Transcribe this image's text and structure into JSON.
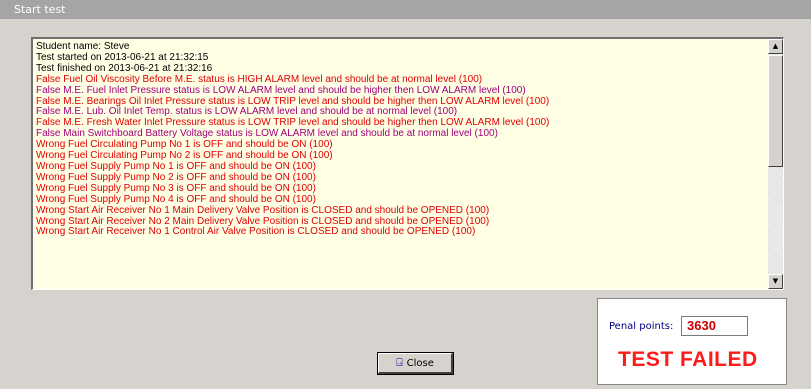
{
  "window": {
    "title": "Start test"
  },
  "log": {
    "lines": [
      {
        "text": "Student name: Steve",
        "color": "#000000"
      },
      {
        "text": "Test started on 2013-06-21 at 21:32:15",
        "color": "#000000"
      },
      {
        "text": "Test finished on 2013-06-21 at 21:32:16",
        "color": "#000000"
      },
      {
        "text": "False Fuel Oil Viscosity Before M.E. status is HIGH ALARM level and should be at normal level (100)",
        "color": "#e00000"
      },
      {
        "text": "False M.E. Fuel Inlet Pressure status is LOW ALARM level and should be higher then LOW ALARM level (100)",
        "color": "#a0007a"
      },
      {
        "text": "False M.E. Bearings Oil Inlet Pressure status is LOW TRIP level and should be higher then LOW ALARM level (100)",
        "color": "#e00000"
      },
      {
        "text": "False M.E. Lub. Oil Inlet Temp. status is LOW ALARM level and should be at normal level (100)",
        "color": "#a0007a"
      },
      {
        "text": "False M.E. Fresh Water Inlet Pressure status is LOW TRIP level and should be higher then LOW ALARM level (100)",
        "color": "#e00000"
      },
      {
        "text": "False Main Switchboard Battery Voltage status is LOW ALARM level and should be at normal level (100)",
        "color": "#a0007a"
      },
      {
        "text": "Wrong Fuel Circulating Pump No 1 is OFF and should be ON (100)",
        "color": "#e00000"
      },
      {
        "text": "Wrong Fuel Circulating Pump No 2 is OFF and should be ON (100)",
        "color": "#e00000"
      },
      {
        "text": "Wrong Fuel Supply Pump No 1 is OFF and should be ON (100)",
        "color": "#e00000"
      },
      {
        "text": "Wrong Fuel Supply Pump No 2 is OFF and should be ON (100)",
        "color": "#e00000"
      },
      {
        "text": "Wrong Fuel Supply Pump No 3 is OFF and should be ON (100)",
        "color": "#e00000"
      },
      {
        "text": "Wrong Fuel Supply Pump No 4 is OFF and should be ON (100)",
        "color": "#e00000"
      },
      {
        "text": "Wrong Start Air Receiver No 1 Main Delivery Valve Position is CLOSED and should be OPENED (100)",
        "color": "#e00000"
      },
      {
        "text": "Wrong Start Air Receiver No 2 Main Delivery Valve Position is CLOSED and should be OPENED (100)",
        "color": "#e00000"
      },
      {
        "text": "Wrong Start Air Receiver No 1 Control Air Valve Position is CLOSED and should be OPENED (100)",
        "color": "#e00000"
      }
    ]
  },
  "scrollbar": {
    "up_icon": "arrow-up-icon",
    "down_icon": "arrow-down-icon"
  },
  "result": {
    "points_label": "Penal points:",
    "points_value": "3630",
    "verdict": "TEST FAILED",
    "verdict_color": "#ff1a1a"
  },
  "close_button": {
    "label": "Close",
    "icon": "exit-door-icon"
  }
}
